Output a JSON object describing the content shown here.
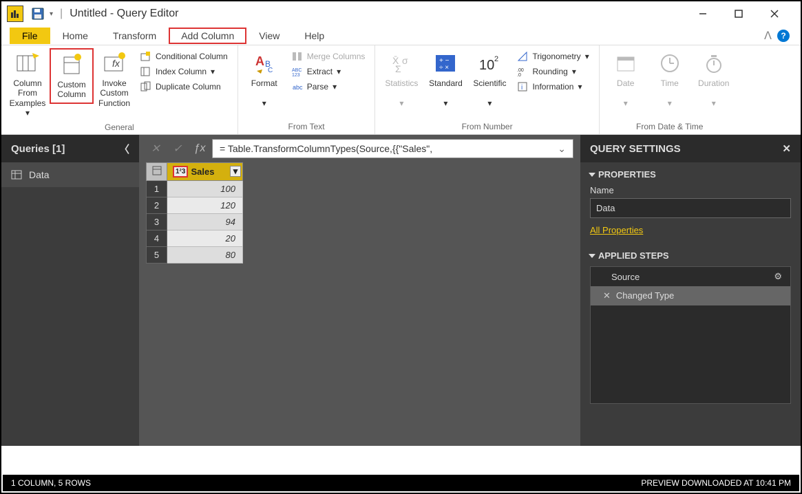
{
  "title": "Untitled - Query Editor",
  "menu": {
    "file": "File",
    "home": "Home",
    "transform": "Transform",
    "add_column": "Add Column",
    "view": "View",
    "help": "Help"
  },
  "ribbon": {
    "general": {
      "label": "General",
      "col_from_examples": "Column From Examples",
      "custom_column": "Custom Column",
      "invoke_custom_fn": "Invoke Custom Function",
      "conditional_column": "Conditional Column",
      "index_column": "Index Column",
      "duplicate_column": "Duplicate Column"
    },
    "from_text": {
      "label": "From Text",
      "format": "Format",
      "merge_columns": "Merge Columns",
      "extract": "Extract",
      "parse": "Parse"
    },
    "from_number": {
      "label": "From Number",
      "statistics": "Statistics",
      "standard": "Standard",
      "scientific": "Scientific",
      "trigonometry": "Trigonometry",
      "rounding": "Rounding",
      "information": "Information"
    },
    "from_datetime": {
      "label": "From Date & Time",
      "date": "Date",
      "time": "Time",
      "duration": "Duration"
    }
  },
  "queries": {
    "header": "Queries [1]",
    "items": [
      "Data"
    ]
  },
  "formula": "= Table.TransformColumnTypes(Source,{{\"Sales\",",
  "table": {
    "column": "Sales",
    "type_icon": "1²3",
    "rows": [
      100,
      120,
      94,
      20,
      80
    ]
  },
  "settings": {
    "header": "QUERY SETTINGS",
    "properties_label": "PROPERTIES",
    "name_label": "Name",
    "name_value": "Data",
    "all_properties": "All Properties",
    "applied_steps_label": "APPLIED STEPS",
    "steps": [
      {
        "label": "Source",
        "gear": true,
        "active": false
      },
      {
        "label": "Changed Type",
        "gear": false,
        "active": true,
        "delete": true
      }
    ]
  },
  "status": {
    "left": "1 COLUMN, 5 ROWS",
    "right": "PREVIEW DOWNLOADED AT 10:41 PM"
  }
}
